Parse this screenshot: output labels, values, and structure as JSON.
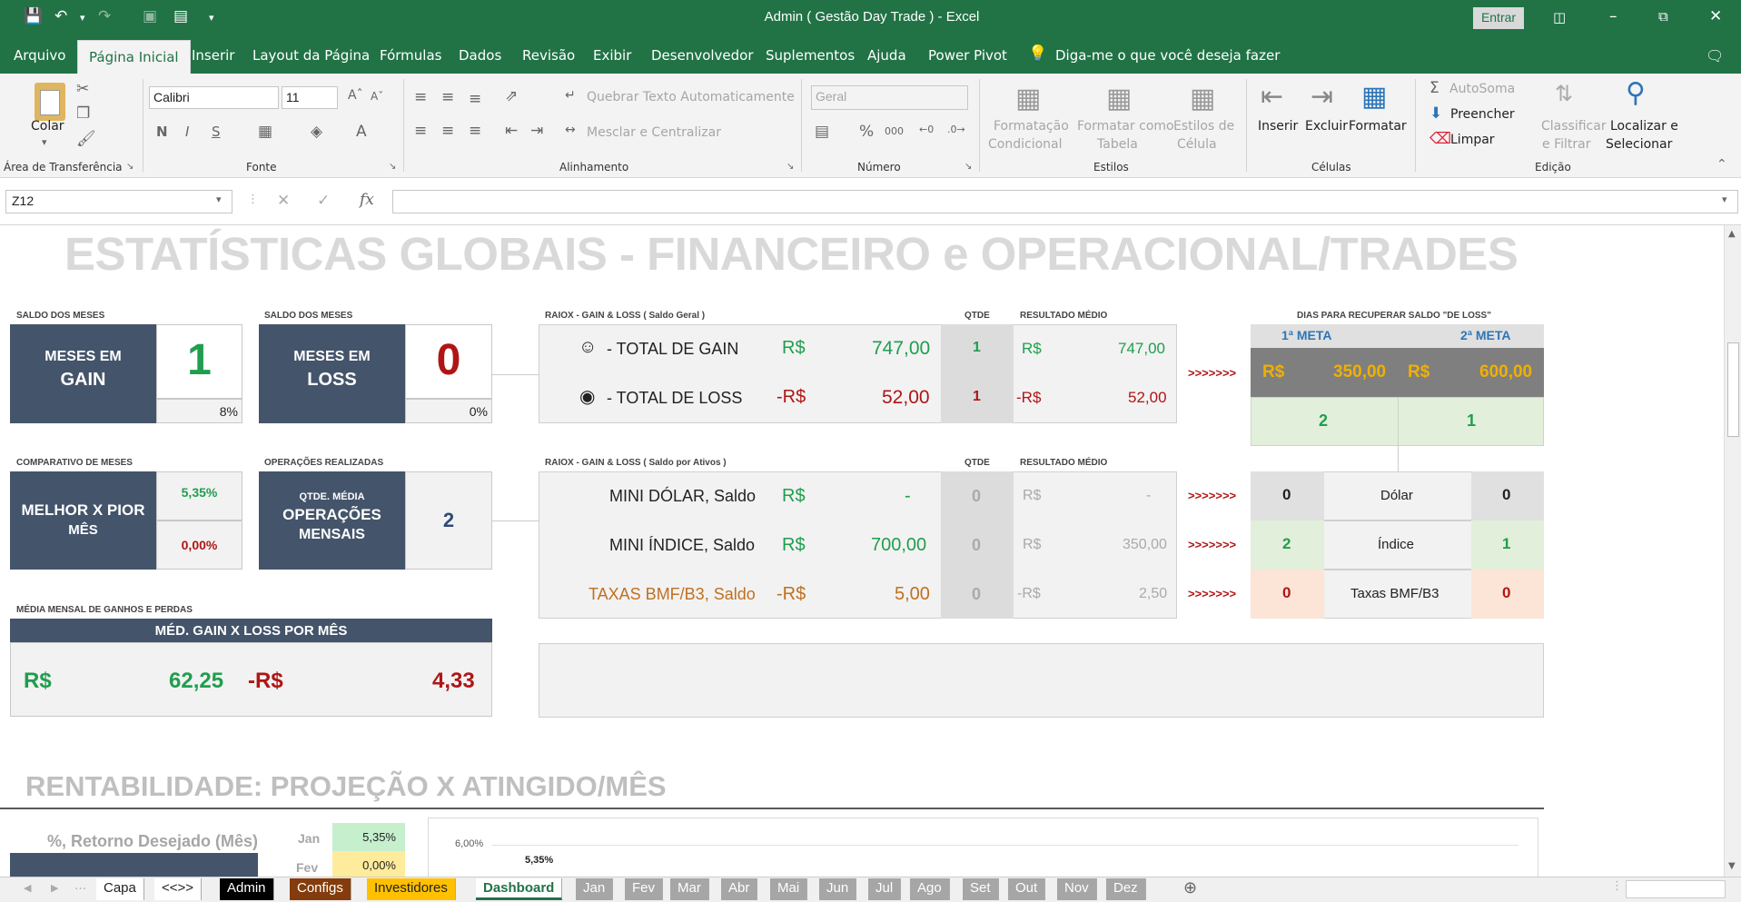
{
  "window": {
    "title": "Admin ( Gestão Day Trade )  -  Excel",
    "signin": "Entrar"
  },
  "ribbon_tabs": [
    "Arquivo",
    "Página Inicial",
    "Inserir",
    "Layout da Página",
    "Fórmulas",
    "Dados",
    "Revisão",
    "Exibir",
    "Desenvolvedor",
    "Suplementos",
    "Ajuda",
    "Power Pivot"
  ],
  "tell_me": "Diga-me o que você deseja fazer",
  "ribbon": {
    "paste": "Colar",
    "clipboard_group": "Área de Transferência",
    "font_name": "Calibri",
    "font_size": "11",
    "font_group": "Fonte",
    "bold": "N",
    "italic": "I",
    "underline": "S",
    "wrap_text": "Quebrar Texto Automaticamente",
    "merge_center": "Mesclar e Centralizar",
    "alignment_group": "Alinhamento",
    "number_format": "Geral",
    "number_group": "Número",
    "cond_format_1": "Formatação",
    "cond_format_2": "Condicional",
    "format_table_1": "Formatar como",
    "format_table_2": "Tabela",
    "cell_styles_1": "Estilos de",
    "cell_styles_2": "Célula",
    "styles_group": "Estilos",
    "insert": "Inserir",
    "delete": "Excluir",
    "format": "Formatar",
    "cells_group": "Células",
    "autosum": "AutoSoma",
    "fill": "Preencher",
    "clear": "Limpar",
    "sort_1": "Classificar",
    "sort_2": "e Filtrar",
    "find_1": "Localizar e",
    "find_2": "Selecionar",
    "editing_group": "Edição"
  },
  "formula_bar": {
    "name_box": "Z12",
    "fx": "fx",
    "formula": ""
  },
  "sheet": {
    "main_title": "ESTATÍSTICAS GLOBAIS - FINANCEIRO e OPERACIONAL/TRADES",
    "saldo_label_1": "SALDO DOS MESES",
    "saldo_label_2": "SALDO DOS MESES",
    "meses_gain_1": "MESES EM",
    "meses_gain_2": "GAIN",
    "meses_gain_value": "1",
    "meses_gain_pct": "8%",
    "meses_loss_1": "MESES EM",
    "meses_loss_2": "LOSS",
    "meses_loss_value": "0",
    "meses_loss_pct": "0%",
    "comparativo_label": "COMPARATIVO DE MESES",
    "melhor_pior_1": "MELHOR X PIOR",
    "melhor_pior_2": "MÊS",
    "melhor_value": "5,35%",
    "pior_value": "0,00%",
    "operacoes_label": "OPERAÇÕES REALIZADAS",
    "qtde_media": "QTDE. MÉDIA",
    "operacoes_1": "OPERAÇÕES",
    "operacoes_2": "MENSAIS",
    "operacoes_value": "2",
    "media_mensal_label": "MÉDIA MENSAL DE GANHOS E PERDAS",
    "med_gain_loss_header": "MÉD. GAIN X LOSS POR MÊS",
    "med_gain_currency": "R$",
    "med_gain_value": "62,25",
    "med_loss_currency": "-R$",
    "med_loss_value": "4,33",
    "raiox_geral_label": "RAIOX - GAIN & LOSS ( Saldo Geral )",
    "qtde_label": "QTDE",
    "resultado_medio_label": "RESULTADO MÉDIO",
    "total_gain_label": "- TOTAL DE GAIN",
    "total_gain_cur": "R$",
    "total_gain_value": "747,00",
    "total_gain_qtde": "1",
    "total_gain_avg_cur": "R$",
    "total_gain_avg": "747,00",
    "total_loss_label": "- TOTAL DE LOSS",
    "total_loss_cur": "-R$",
    "total_loss_value": "52,00",
    "total_loss_qtde": "1",
    "total_loss_avg_cur": "-R$",
    "total_loss_avg": "52,00",
    "raiox_ativos_label": "RAIOX - GAIN & LOSS ( Saldo por Ativos )",
    "qtde_label_2": "QTDE",
    "resultado_medio_label_2": "RESULTADO MÉDIO",
    "assets": [
      {
        "label": "MINI DÓLAR, Saldo",
        "cur": "R$",
        "value": "-",
        "qtde": "0",
        "avg_cur": "R$",
        "avg": "-",
        "arrow": ">>>>>>>",
        "c1": "0",
        "name": "Dólar",
        "c2": "0"
      },
      {
        "label": "MINI ÍNDICE, Saldo",
        "cur": "R$",
        "value": "700,00",
        "qtde": "0",
        "avg_cur": "R$",
        "avg": "350,00",
        "arrow": ">>>>>>>",
        "c1": "2",
        "name": "Índice",
        "c2": "1"
      },
      {
        "label": "TAXAS BMF/B3, Saldo",
        "cur": "-R$",
        "value": "5,00",
        "qtde": "0",
        "avg_cur": "-R$",
        "avg": "2,50",
        "arrow": ">>>>>>>",
        "c1": "0",
        "name": "Taxas BMF/B3",
        "c2": "0"
      }
    ],
    "dias_label": "DIAS PARA RECUPERAR SALDO \"DE LOSS\"",
    "meta1_label": "1ª META",
    "meta2_label": "2ª META",
    "meta_arrow": ">>>>>>>",
    "meta1_cur": "R$",
    "meta1_value": "350,00",
    "meta2_cur": "R$",
    "meta2_value": "600,00",
    "meta1_days": "2",
    "meta2_days": "1",
    "rent_title": "RENTABILIDADE: PROJEÇÃO X ATINGIDO/MÊS",
    "retorno_label": "%, Retorno Desejado (Mês)",
    "months": [
      {
        "m": "Jan",
        "v": "5,35%"
      },
      {
        "m": "Fev",
        "v": "0,00%"
      }
    ],
    "chart_tick": "6,00%",
    "chart_label": "5,35%"
  },
  "sheet_tabs": [
    "Capa",
    "<<>>",
    "Admin",
    "Configs",
    "Investidores",
    "Dashboard",
    "Jan",
    "Fev",
    "Mar",
    "Abr",
    "Mai",
    "Jun",
    "Jul",
    "Ago",
    "Set",
    "Out",
    "Nov",
    "Dez"
  ],
  "colors": {
    "excel_green": "#217346",
    "navy": "#44546a",
    "gain": "#1f9e4d",
    "loss": "#b01515",
    "orange": "#d08a2a"
  }
}
